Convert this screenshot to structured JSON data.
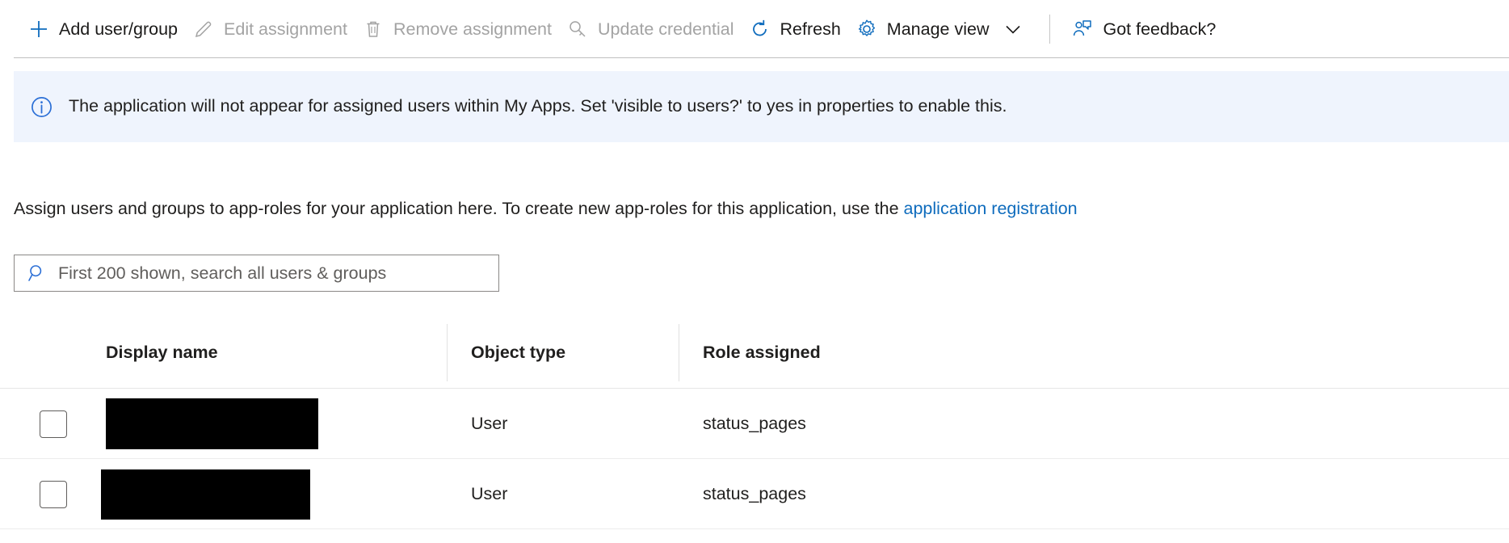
{
  "toolbar": {
    "items": [
      {
        "id": "add-user-group",
        "label": "Add user/group",
        "icon": "plus-icon",
        "disabled": false
      },
      {
        "id": "edit-assignment",
        "label": "Edit assignment",
        "icon": "pencil-icon",
        "disabled": true
      },
      {
        "id": "remove-assignment",
        "label": "Remove assignment",
        "icon": "trash-icon",
        "disabled": true
      },
      {
        "id": "update-credential",
        "label": "Update credential",
        "icon": "key-icon",
        "disabled": true
      },
      {
        "id": "refresh",
        "label": "Refresh",
        "icon": "refresh-icon",
        "disabled": false
      },
      {
        "id": "manage-view",
        "label": "Manage view",
        "icon": "gear-icon",
        "disabled": false,
        "chevron": "chevron-down-icon"
      },
      {
        "id": "got-feedback",
        "label": "Got feedback?",
        "icon": "feedback-person-icon",
        "disabled": false
      }
    ]
  },
  "banner": {
    "icon": "info-circle-icon",
    "text": "The application will not appear for assigned users within My Apps. Set 'visible to users?' to yes in properties to enable this.",
    "background": "#eff4fd"
  },
  "description": {
    "before_link": "Assign users and groups to app-roles for your application here. To create new app-roles for this application, use the ",
    "link_text": "application registration",
    "link_color": "#0f6cbd"
  },
  "search": {
    "icon": "search-icon",
    "placeholder": "First 200 shown, search all users & groups",
    "value": ""
  },
  "table": {
    "columns": [
      "Display name",
      "Object type",
      "Role assigned"
    ],
    "rows": [
      {
        "display_name": "",
        "redacted": true,
        "object_type": "User",
        "role_assigned": "status_pages",
        "checked": false
      },
      {
        "display_name": "",
        "redacted": true,
        "object_type": "User",
        "role_assigned": "status_pages",
        "checked": false
      }
    ]
  },
  "colors": {
    "accent": "#0f6cbd",
    "text": "#201f1e",
    "disabled_text": "#a3a3a3",
    "border": "#e1e1e1"
  }
}
